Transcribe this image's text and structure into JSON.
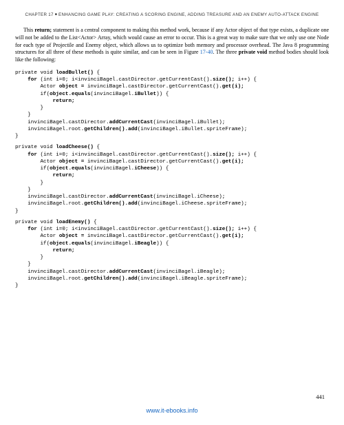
{
  "header": {
    "chapter": "CHAPTER 17",
    "title": "ENHANCING GAME PLAY: CREATING A SCORING ENGINE, ADDING TREASURE AND AN ENEMY AUTO-ATTACK ENGINE"
  },
  "paragraph": {
    "p1a": "This ",
    "p1b": "return;",
    "p1c": " statement is a central component to making this method work, because if any Actor object of that type exists, a duplicate one will not be added to the List<Actor> Array, which would cause an error to occur. This is a great way to make sure that we only use one Node for each type of Projectile and Enemy object, which allows us to optimize both memory and processor overhead. The Java 8 programming structures for all three of these methods is quite similar, and can be seen in Figure ",
    "p1fig": "17-40",
    "p1d": ". The three ",
    "p1e": "private void",
    "p1f": " method bodies should look like the following:"
  },
  "code": {
    "bullet": {
      "l1a": "private void ",
      "l1b": "loadBullet()",
      "l1c": " {",
      "l2a": "    for",
      "l2b": " (int i=0; i<invinciBagel.castDirector.getCurrentCast().",
      "l2c": "size();",
      "l2d": " i++) {",
      "l3a": "        Actor ",
      "l3b": "object =",
      "l3c": " invinciBagel.castDirector.getCurrentCast().",
      "l3d": "get(i);",
      "l4a": "        if(",
      "l4b": "object.equals",
      "l4c": "(invinciBagel.",
      "l4d": "iBullet",
      "l4e": ")) {",
      "l5": "            return;",
      "l6": "        }",
      "l7": "    }",
      "l8a": "    invinciBagel.castDirector.",
      "l8b": "addCurrentCast",
      "l8c": "(invinciBagel.iBullet);",
      "l9a": "    invinciBagel.root.",
      "l9b": "getChildren().add",
      "l9c": "(invinciBagel.iBullet.spriteFrame);",
      "l10": "}"
    },
    "cheese": {
      "l1a": "private void ",
      "l1b": "loadCheese()",
      "l1c": " {",
      "l2a": "    for",
      "l2b": " (int i=0; i<invinciBagel.castDirector.getCurrentCast().",
      "l2c": "size();",
      "l2d": " i++) {",
      "l3a": "        Actor ",
      "l3b": "object =",
      "l3c": " invinciBagel.castDirector.getCurrentCast().",
      "l3d": "get(i);",
      "l4a": "        if(",
      "l4b": "object.equals",
      "l4c": "(invinciBagel.",
      "l4d": "iCheese",
      "l4e": ")) {",
      "l5": "            return;",
      "l6": "        }",
      "l7": "    }",
      "l8a": "    invinciBagel.castDirector.",
      "l8b": "addCurrentCast",
      "l8c": "(invinciBagel.iCheese);",
      "l9a": "    invinciBagel.root.",
      "l9b": "getChildren().add",
      "l9c": "(invinciBagel.iCheese.spriteFrame);",
      "l10": "}"
    },
    "enemy": {
      "l1a": "private void ",
      "l1b": "loadEnemy()",
      "l1c": " {",
      "l2a": "    for",
      "l2b": " (int i=0; i<invinciBagel.castDirector.getCurrentCast().",
      "l2c": "size();",
      "l2d": " i++) {",
      "l3a": "        Actor ",
      "l3b": "object =",
      "l3c": " invinciBagel.castDirector.getCurrentCast().",
      "l3d": "get(i);",
      "l4a": "        if(",
      "l4b": "object.equals",
      "l4c": "(invinciBagel.",
      "l4d": "iBeagle",
      "l4e": ")) {",
      "l5": "            return;",
      "l6": "        }",
      "l7": "    }",
      "l8a": "    invinciBagel.castDirector.",
      "l8b": "addCurrentCast",
      "l8c": "(invinciBagel.iBeagle);",
      "l9a": "    invinciBagel.root.",
      "l9b": "getChildren().add",
      "l9c": "(invinciBagel.iBeagle.spriteFrame);",
      "l10": "}"
    }
  },
  "pageNumber": "441",
  "footerLink": "www.it-ebooks.info"
}
